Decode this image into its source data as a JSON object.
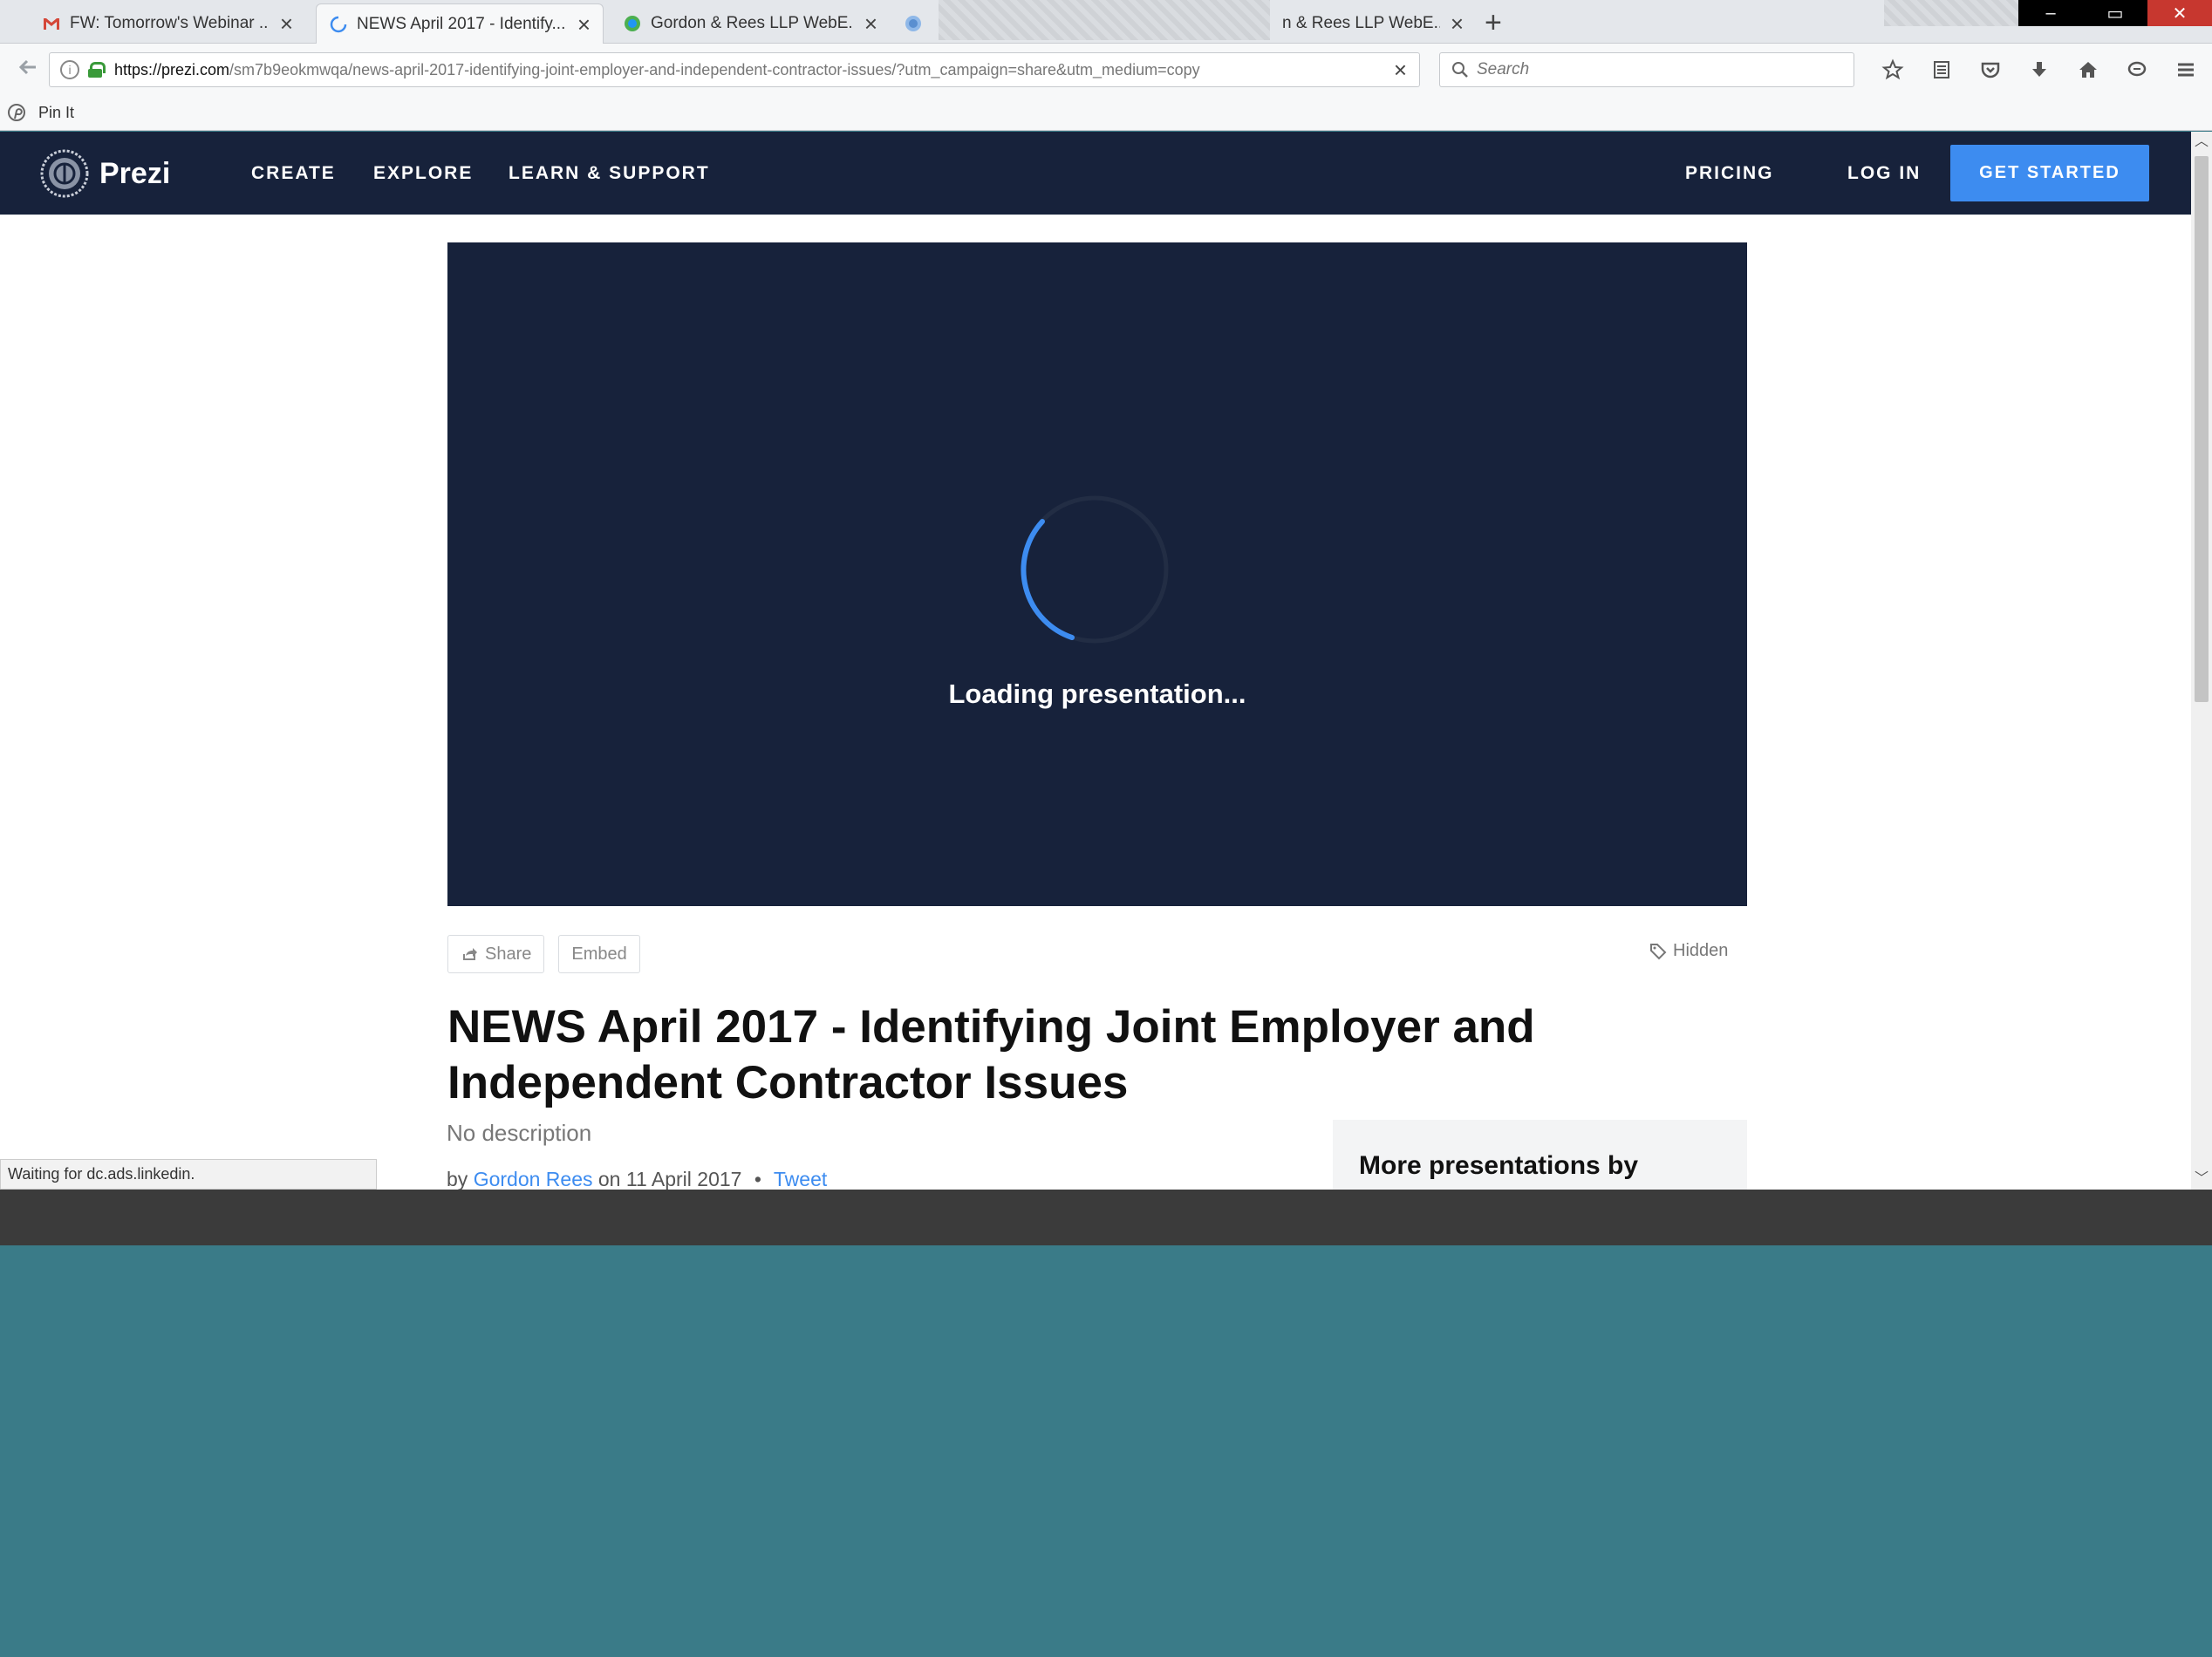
{
  "browser": {
    "tabs": [
      {
        "label": "FW: Tomorrow's Webinar ...",
        "icon": "gmail-icon"
      },
      {
        "label": "NEWS April 2017 - Identify...",
        "icon": "loading-icon"
      },
      {
        "label": "Gordon & Rees LLP WebE...",
        "icon": "browser-favicon-icon"
      },
      {
        "label": "",
        "icon": "globe-icon"
      },
      {
        "label": "n & Rees LLP WebE...",
        "icon": ""
      }
    ],
    "new_tab": "+",
    "url_host": "https://prezi.com",
    "url_path": "/sm7b9eokmwqa/news-april-2017-identifying-joint-employer-and-independent-contractor-issues/?utm_campaign=share&utm_medium=copy",
    "search_placeholder": "Search",
    "bookmark": "Pin It",
    "status_tooltip": "Waiting for dc.ads.linkedin."
  },
  "site": {
    "logo_text": "Prezi",
    "nav": {
      "create": "CREATE",
      "explore": "EXPLORE",
      "learn": "LEARN & SUPPORT",
      "pricing": "PRICING",
      "login": "LOG IN",
      "get_started": "GET STARTED"
    },
    "brand_colors": {
      "header": "#17223b",
      "accent": "#3d8cf0"
    }
  },
  "player": {
    "loading_text": "Loading presentation..."
  },
  "actions": {
    "share": "Share",
    "embed": "Embed",
    "visibility": "Hidden"
  },
  "presentation": {
    "title_line1": "NEWS April 2017 - Identifying Joint Employer and",
    "title_line2": "Independent Contractor Issues",
    "description": "No description",
    "by_prefix": "by",
    "author": "Gordon Rees",
    "date_prefix": "on",
    "date": "11 April 2017",
    "bullet": "•",
    "tweet": "Tweet",
    "more_title": "More presentations by"
  }
}
